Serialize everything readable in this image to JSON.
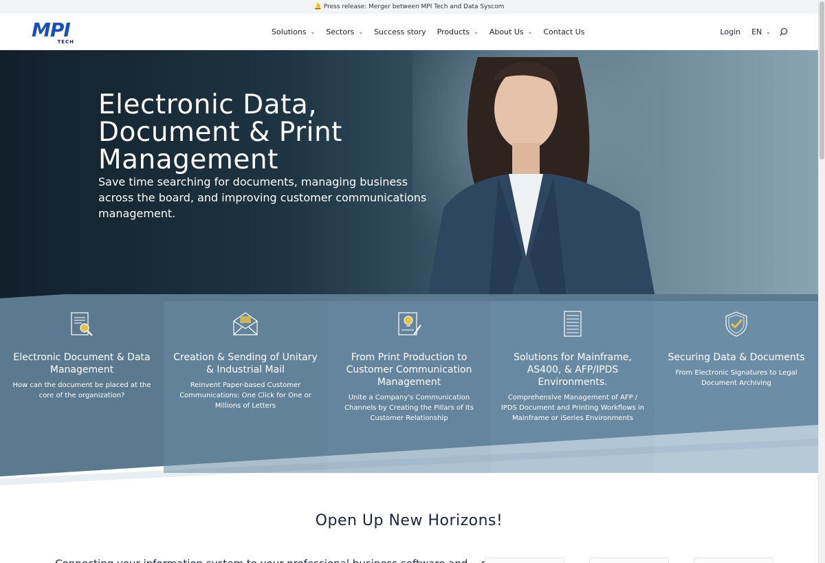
{
  "announcement": {
    "text": "Press release: Merger between MPI Tech and Data Syscom",
    "icon": "bell-icon"
  },
  "brand": {
    "logo_text": "MPI",
    "logo_sub": "TECH",
    "primary_color": "#1b4fb7"
  },
  "nav": {
    "items": [
      {
        "label": "Solutions",
        "has_dropdown": true
      },
      {
        "label": "Sectors",
        "has_dropdown": true
      },
      {
        "label": "Success story",
        "has_dropdown": false
      },
      {
        "label": "Products",
        "has_dropdown": true
      },
      {
        "label": "About Us",
        "has_dropdown": true
      },
      {
        "label": "Contact Us",
        "has_dropdown": false
      }
    ],
    "login": "Login",
    "language": "EN"
  },
  "hero": {
    "title": "Electronic Data, Document & Print Management",
    "subtitle": "Save time searching for documents, managing business across the board, and improving customer communications management."
  },
  "cards": [
    {
      "icon": "document-search-icon",
      "title": "Electronic Document & Data Management",
      "text": "How can the document be placed at the core of the organization?",
      "bg": "#5f7f95"
    },
    {
      "icon": "envelope-icon",
      "title": "Creation & Sending of Unitary & Industrial Mail",
      "text": "Reinvent Paper-based Customer Communications: One Click for One or Millions of Letters",
      "bg": "#6688a0"
    },
    {
      "icon": "lightbulb-document-icon",
      "title": "From Print Production to Customer Communication Management",
      "text": "Unite a Company's Communication Channels by Creating the Pillars of Its Customer Relationship",
      "bg": "#6c8ea8"
    },
    {
      "icon": "server-icon",
      "title": "Solutions for Mainframe, AS400, & AFP/IPDS Environments.",
      "text": "Comprehensive Management of AFP / IPDS Document and Printing Workflows in Mainframe or iSeries Environments",
      "bg": "#7196b0"
    },
    {
      "icon": "shield-check-icon",
      "title": "Securing Data & Documents",
      "text": "From Electronic Signatures to Legal Document Archiving",
      "bg": "#789db6"
    }
  ],
  "section2": {
    "title": "Open Up New Horizons!",
    "body_start": "Connecting your information system to your professional business software and... designed for"
  }
}
